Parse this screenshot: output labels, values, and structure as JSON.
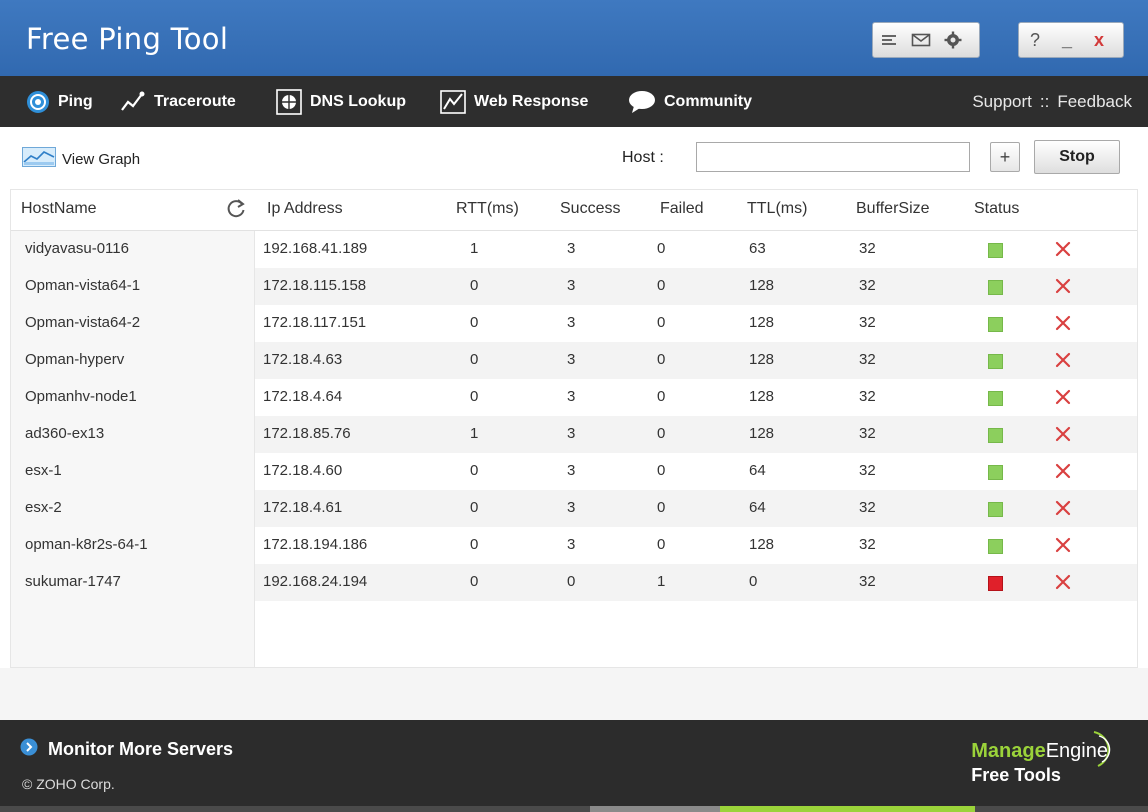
{
  "app": {
    "title": "Free Ping Tool"
  },
  "titlebar": {
    "tools": [
      "notes-icon",
      "mail-icon",
      "settings-icon"
    ],
    "window_controls": {
      "help": "?",
      "minimize": "_",
      "close": "x"
    }
  },
  "nav": {
    "items": [
      {
        "label": "Ping",
        "icon": "ping-icon"
      },
      {
        "label": "Traceroute",
        "icon": "traceroute-icon"
      },
      {
        "label": "DNS Lookup",
        "icon": "dns-icon"
      },
      {
        "label": "Web Response",
        "icon": "web-response-icon"
      },
      {
        "label": "Community",
        "icon": "chat-bubble-icon"
      }
    ],
    "support": "Support",
    "separator": "::",
    "feedback": "Feedback"
  },
  "toolbar": {
    "view_graph": "View Graph",
    "host_label": "Host :",
    "host_value": "",
    "add_label": "+",
    "stop_label": "Stop"
  },
  "table": {
    "columns": [
      "HostName",
      "Ip Address",
      "RTT(ms)",
      "Success",
      "Failed",
      "TTL(ms)",
      "BufferSize",
      "Status"
    ],
    "rows": [
      {
        "host": "vidyavasu-0116",
        "ip": "192.168.41.189",
        "rtt": "1",
        "success": "3",
        "failed": "0",
        "ttl": "63",
        "buffer": "32",
        "status": "up"
      },
      {
        "host": "Opman-vista64-1",
        "ip": "172.18.115.158",
        "rtt": "0",
        "success": "3",
        "failed": "0",
        "ttl": "128",
        "buffer": "32",
        "status": "up"
      },
      {
        "host": "Opman-vista64-2",
        "ip": "172.18.117.151",
        "rtt": "0",
        "success": "3",
        "failed": "0",
        "ttl": "128",
        "buffer": "32",
        "status": "up"
      },
      {
        "host": "Opman-hyperv",
        "ip": "172.18.4.63",
        "rtt": "0",
        "success": "3",
        "failed": "0",
        "ttl": "128",
        "buffer": "32",
        "status": "up"
      },
      {
        "host": "Opmanhv-node1",
        "ip": "172.18.4.64",
        "rtt": "0",
        "success": "3",
        "failed": "0",
        "ttl": "128",
        "buffer": "32",
        "status": "up"
      },
      {
        "host": "ad360-ex13",
        "ip": "172.18.85.76",
        "rtt": "1",
        "success": "3",
        "failed": "0",
        "ttl": "128",
        "buffer": "32",
        "status": "up"
      },
      {
        "host": "esx-1",
        "ip": "172.18.4.60",
        "rtt": "0",
        "success": "3",
        "failed": "0",
        "ttl": "64",
        "buffer": "32",
        "status": "up"
      },
      {
        "host": "esx-2",
        "ip": "172.18.4.61",
        "rtt": "0",
        "success": "3",
        "failed": "0",
        "ttl": "64",
        "buffer": "32",
        "status": "up"
      },
      {
        "host": "opman-k8r2s-64-1",
        "ip": "172.18.194.186",
        "rtt": "0",
        "success": "3",
        "failed": "0",
        "ttl": "128",
        "buffer": "32",
        "status": "up"
      },
      {
        "host": "sukumar-1747",
        "ip": "192.168.24.194",
        "rtt": "0",
        "success": "0",
        "failed": "1",
        "ttl": "0",
        "buffer": "32",
        "status": "down"
      }
    ]
  },
  "footer": {
    "monitor_more": "Monitor More Servers",
    "copyright": "© ZOHO Corp.",
    "brand_manage": "Manage",
    "brand_engine": "Engine",
    "brand_free_tools": "Free Tools"
  },
  "colors": {
    "titlebar_blue": "#3169b0",
    "nav_dark": "#2e2e2e",
    "status_up": "#8ccf5d",
    "status_down": "#e0202a",
    "delete_red": "#d94040",
    "brand_green": "#9bd33a"
  }
}
